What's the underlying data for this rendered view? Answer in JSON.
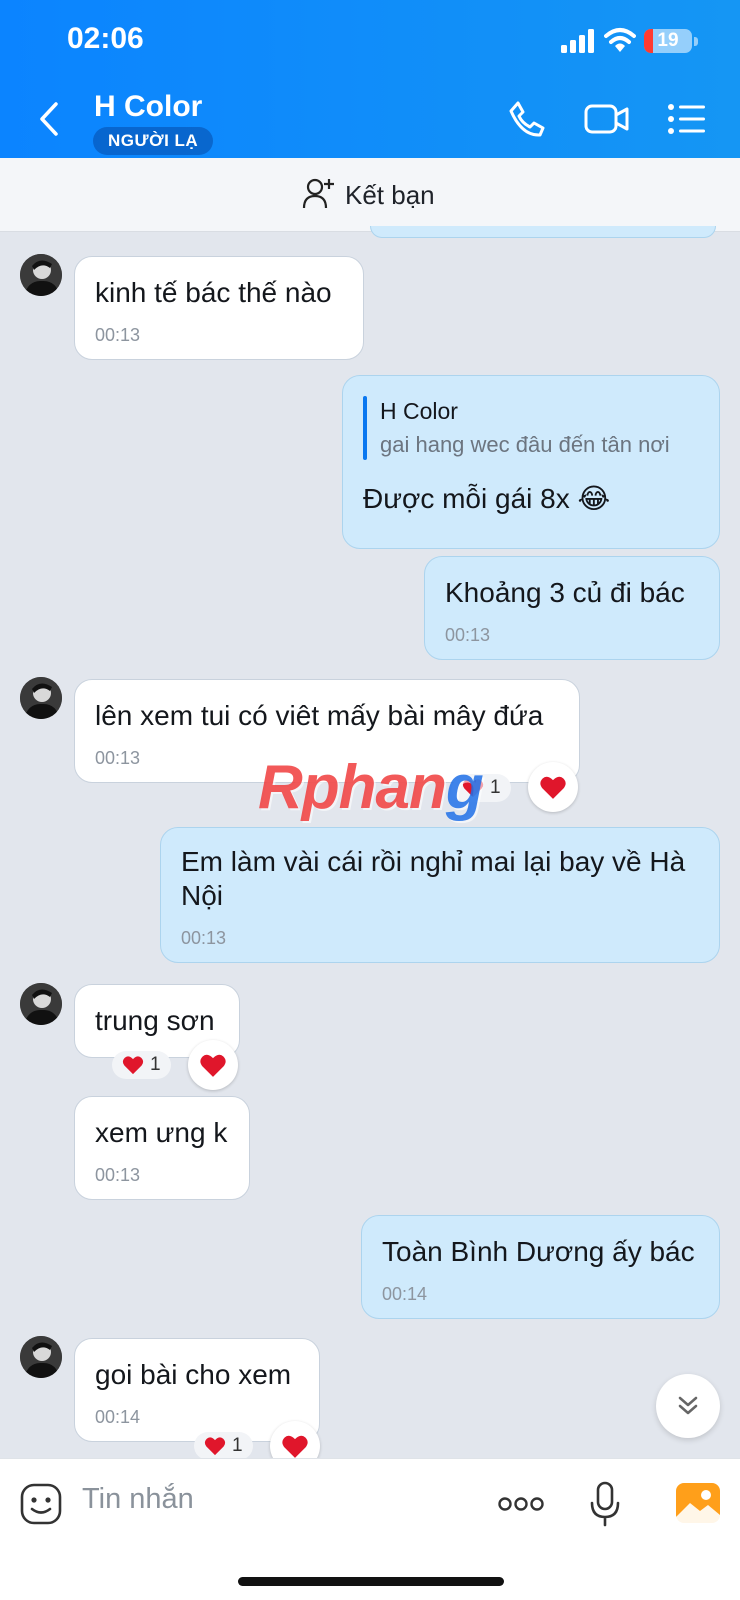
{
  "status_bar": {
    "time": "02:06",
    "battery": "19",
    "battery_level": 0.19
  },
  "header": {
    "title": "H Color",
    "badge": "NGƯỜI LẠ"
  },
  "friend_bar": {
    "label": "Kết bạn"
  },
  "messages": [
    {
      "dir": "in",
      "text": "kinh tế bác thế nào",
      "time": "00:13"
    },
    {
      "dir": "out",
      "quote_name": "H Color",
      "quote_text": "gai hang wec đâu đến tân nơi",
      "text": "Được mỗi gái 8x 😂"
    },
    {
      "dir": "out",
      "text": "Khoảng 3 củ đi bác",
      "time": "00:13"
    },
    {
      "dir": "in",
      "text": "lên xem tui có viêt mấy bài mây đứa",
      "time": "00:13",
      "reaction_count": "1"
    },
    {
      "dir": "out",
      "text_line1": "Em làm vài cái rồi nghỉ mai lại bay về Hà",
      "text_line2": "Nội",
      "time": "00:13"
    },
    {
      "dir": "in",
      "text": "trung sơn",
      "reaction_count": "1"
    },
    {
      "dir": "in",
      "text": "xem ưng k",
      "time": "00:13"
    },
    {
      "dir": "out",
      "text": "Toàn Bình Dương ấy bác",
      "time": "00:14"
    },
    {
      "dir": "in",
      "text": "goi bài cho xem",
      "time": "00:14",
      "reaction_count": "1"
    }
  ],
  "watermark": {
    "part1": "Rphan",
    "part2": "g"
  },
  "composer": {
    "placeholder": "Tin nhắn"
  },
  "colors": {
    "header": "#0b84ff",
    "outgoing_bubble": "#cfeafc",
    "incoming_bubble": "#ffffff",
    "chat_bg": "#e2e6ed",
    "heart": "#e0162b"
  },
  "icons": [
    "back-icon",
    "phone-icon",
    "video-call-icon",
    "menu-list-icon",
    "add-friend-icon",
    "heart-icon",
    "chevron-down-icon",
    "sticker-icon",
    "more-icon",
    "microphone-icon",
    "image-icon"
  ]
}
